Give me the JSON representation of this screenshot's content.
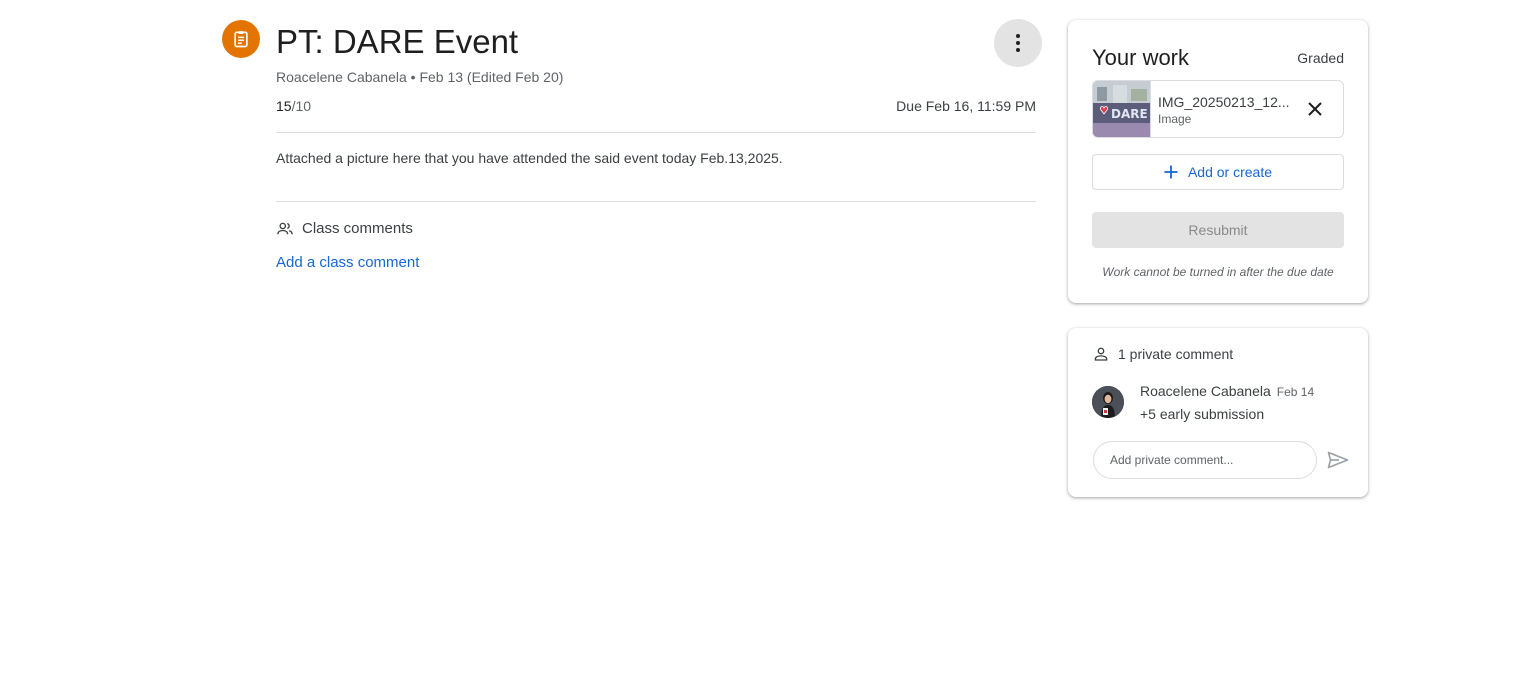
{
  "assignment": {
    "icon": "assignment-icon",
    "accent_color": "#e37400",
    "title": "PT: DARE Event",
    "meta": "Roacelene Cabanela • Feb 13 (Edited Feb 20)",
    "points_earned": "15",
    "points_total": "/10",
    "due": "Due Feb 16, 11:59 PM",
    "instructions": "Attached a picture here that you have attended the said event today Feb.13,2025."
  },
  "class_comments": {
    "icon": "people-icon",
    "label": "Class comments",
    "add_link": "Add a class comment"
  },
  "your_work": {
    "title": "Your work",
    "status": "Graded",
    "attachment": {
      "name": "IMG_20250213_12...",
      "type": "Image"
    },
    "add_or_create": "Add or create",
    "resubmit": "Resubmit",
    "note": "Work cannot be turned in after the due date"
  },
  "private_comments": {
    "icon": "person-icon",
    "header": "1 private comment",
    "comments": [
      {
        "author": "Roacelene Cabanela",
        "date": "Feb 14",
        "text": "+5 early submission"
      }
    ],
    "input_placeholder": "Add private comment..."
  },
  "colors": {
    "link_blue": "#1967d2",
    "assignment_orange": "#e37400"
  }
}
